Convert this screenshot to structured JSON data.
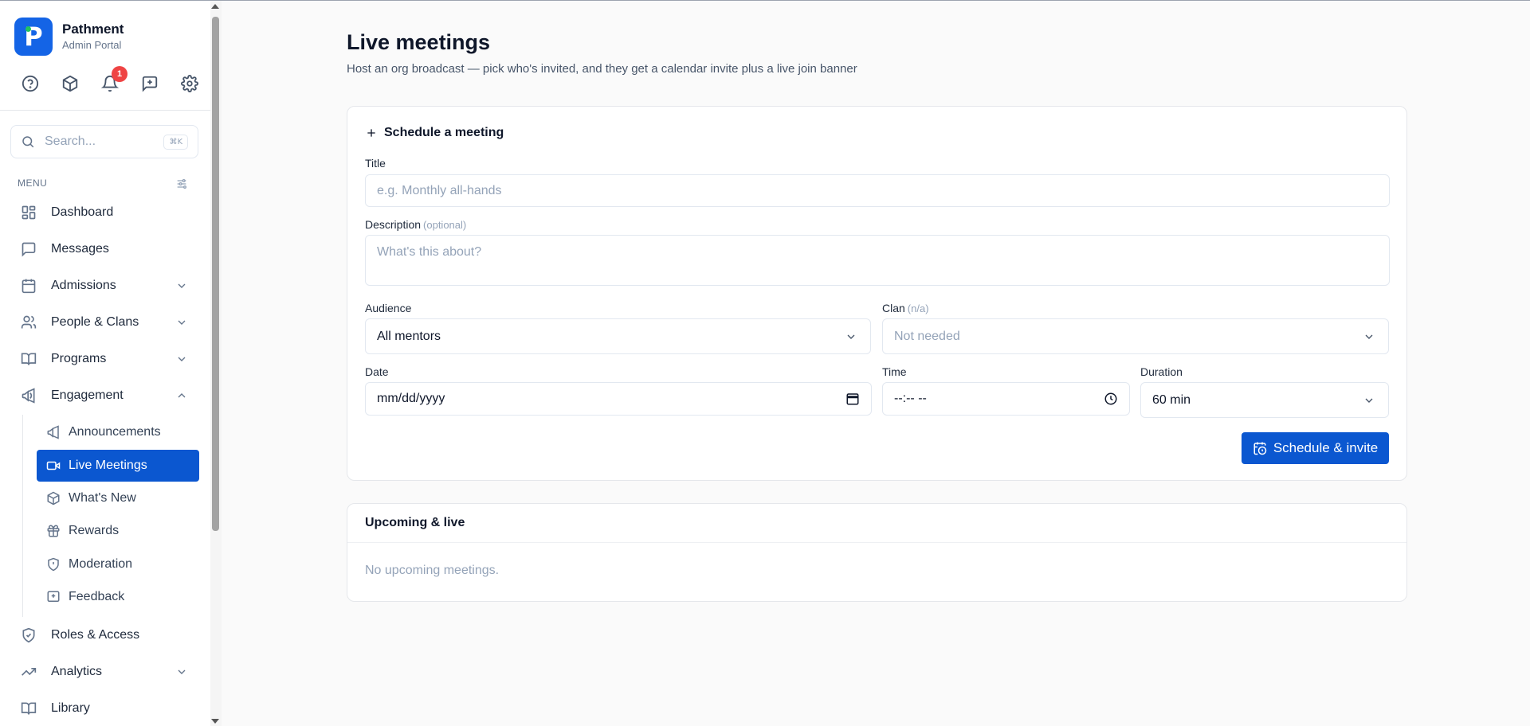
{
  "brand": {
    "name": "Pathment",
    "subtitle": "Admin Portal",
    "logo_letter": "P"
  },
  "toolbar": {
    "notification_count": "1"
  },
  "search": {
    "placeholder": "Search...",
    "shortcut": "⌘K"
  },
  "menu": {
    "label": "MENU"
  },
  "nav": {
    "dashboard": "Dashboard",
    "messages": "Messages",
    "admissions": "Admissions",
    "people": "People & Clans",
    "programs": "Programs",
    "engagement": "Engagement",
    "roles": "Roles & Access",
    "analytics": "Analytics",
    "library": "Library"
  },
  "engagement_sub": {
    "announcements": "Announcements",
    "live_meetings": "Live Meetings",
    "whats_new": "What's New",
    "rewards": "Rewards",
    "moderation": "Moderation",
    "feedback": "Feedback"
  },
  "page": {
    "title": "Live meetings",
    "subtitle": "Host an org broadcast — pick who's invited, and they get a calendar invite plus a live join banner"
  },
  "schedule": {
    "heading": "Schedule a meeting",
    "title_label": "Title",
    "title_placeholder": "e.g. Monthly all-hands",
    "description_label": "Description",
    "description_optional": "(optional)",
    "description_placeholder": "What's this about?",
    "audience_label": "Audience",
    "audience_value": "All mentors",
    "clan_label": "Clan",
    "clan_na": "(n/a)",
    "clan_value": "Not needed",
    "date_label": "Date",
    "date_value": "mm/dd/yyyy",
    "time_label": "Time",
    "time_value": "--:-- --",
    "duration_label": "Duration",
    "duration_value": "60 min",
    "submit_label": "Schedule & invite"
  },
  "upcoming": {
    "heading": "Upcoming & live",
    "empty": "No upcoming meetings."
  },
  "colors": {
    "accent": "#0b57d0",
    "logo": "#1464e6",
    "badge": "#ef4444"
  }
}
